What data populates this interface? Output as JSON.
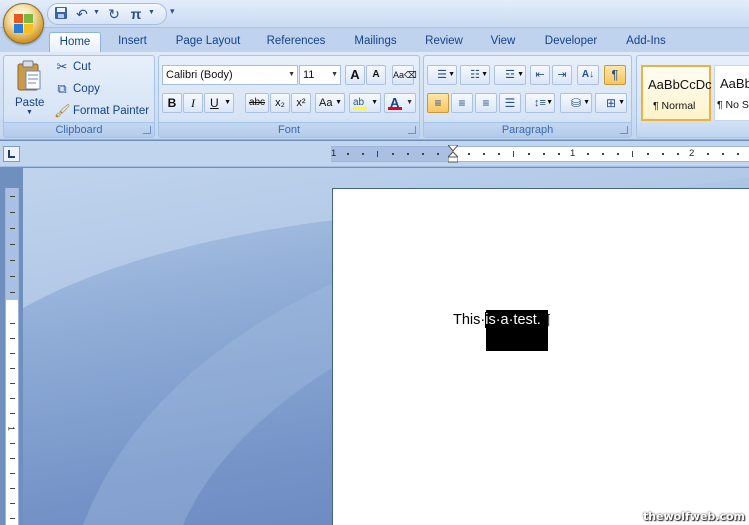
{
  "quick_access": {
    "save_icon": "save-icon",
    "undo_icon": "undo-icon",
    "redo_icon": "redo-icon",
    "equation_label": "π",
    "customize_label": "▾"
  },
  "tabs": [
    {
      "label": "Home"
    },
    {
      "label": "Insert"
    },
    {
      "label": "Page Layout"
    },
    {
      "label": "References"
    },
    {
      "label": "Mailings"
    },
    {
      "label": "Review"
    },
    {
      "label": "View"
    },
    {
      "label": "Developer"
    },
    {
      "label": "Add-Ins"
    }
  ],
  "clipboard": {
    "group_label": "Clipboard",
    "paste_label": "Paste",
    "cut_label": "Cut",
    "copy_label": "Copy",
    "format_painter_label": "Format Painter"
  },
  "font": {
    "group_label": "Font",
    "font_name": "Calibri (Body)",
    "font_size": "11",
    "bold": "B",
    "italic": "I",
    "underline": "U",
    "strikethrough": "abc",
    "subscript": "x₂",
    "superscript": "x²",
    "change_case": "Aa",
    "grow": "A",
    "shrink": "A"
  },
  "paragraph": {
    "group_label": "Paragraph",
    "show_marks": "¶"
  },
  "styles": [
    {
      "sample": "AaBbCcDc",
      "name": "¶ Normal"
    },
    {
      "sample": "AaBb",
      "name": "¶ No S"
    }
  ],
  "ruler": {
    "numbers": [
      "1",
      "1",
      "2"
    ]
  },
  "document": {
    "text_before": "This·",
    "text_selected": "is·a·test.",
    "pilcrow": "¶"
  },
  "watermark": "thewolfweb.com",
  "colors": {
    "ribbon": "#d1e0f4",
    "selection": "#000000",
    "highlight": "#f8c560",
    "font_color_bar": "#e8001c"
  }
}
